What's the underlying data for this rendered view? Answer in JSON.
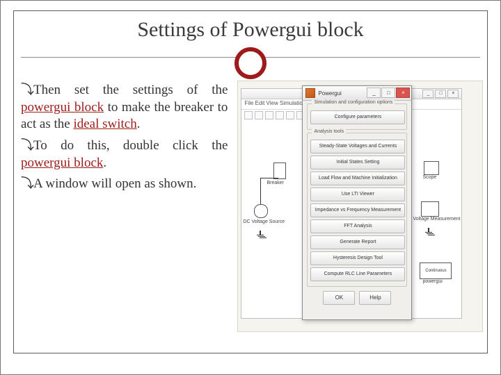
{
  "title": "Settings of Powergui block",
  "text": {
    "b1a": "Then set the settings of the ",
    "b1b": "powergui block",
    "b1c": " to make the breaker to act as the ",
    "b1d": "ideal switch",
    "b1e": ".",
    "b2a": "To do this, double click the ",
    "b2b": "powergui block",
    "b2c": ".",
    "b3": "A window will open as shown."
  },
  "sim": {
    "menu": "File  Edit  View  Simulation",
    "labels": {
      "breaker": "Breaker",
      "source": "DC Voltage Source",
      "scope": "Scope",
      "vmeas": "Voltage Measurement",
      "pgui": "powergui",
      "cont": "Continuous"
    }
  },
  "dlg": {
    "title": "Powergui",
    "group1": "Simulation and configuration options",
    "g1btn": "Configure parameters",
    "group2": "Analysis tools",
    "buttons": [
      "Steady-State Voltages and Currents",
      "Initial States Setting",
      "Load Flow and Machine Initialization",
      "Use LTI Viewer",
      "Impedance vs Frequency Measurement",
      "FFT Analysis",
      "Generate Report",
      "Hysteresis Design Tool",
      "Compute RLC Line Parameters"
    ],
    "ok": "OK",
    "help": "Help"
  }
}
